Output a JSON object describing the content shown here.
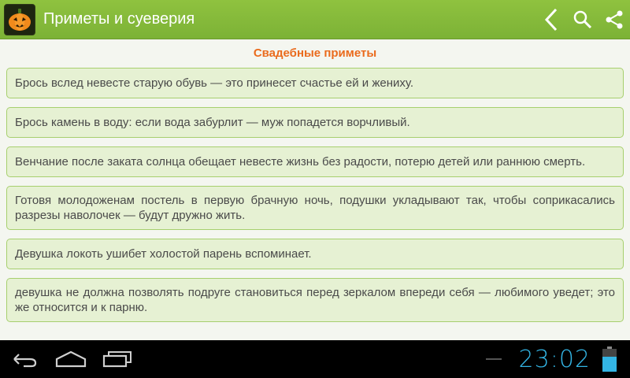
{
  "app": {
    "title": "Приметы и суеверия",
    "icon": "pumpkin-icon"
  },
  "actions": [
    {
      "name": "back-icon"
    },
    {
      "name": "search-icon"
    },
    {
      "name": "share-icon"
    }
  ],
  "section": {
    "title": "Свадебные приметы"
  },
  "items": [
    "Брось вслед невесте старую обувь — это принесет счастье ей и жениху.",
    "Брось камень в воду: если вода забурлит — муж попадется ворчливый.",
    "Венчание после заката солнца обещает невесте жизнь без радости, потерю детей или раннюю смерть.",
    "Готовя молодоженам постель в первую брачную ночь, подушки укладывают так, чтобы соприкасались разрезы наволочек — будут дружно жить.",
    "Девушка локоть ушибет холостой парень вспоминает.",
    "девушка не должна позволять подруге становиться перед зеркалом впереди себя — любимого уведет; это же относится и к парню."
  ],
  "status": {
    "time": "23:02"
  },
  "colors": {
    "actionbar": "#7cb236",
    "accent": "#ea6b1d",
    "card_bg": "#e6f1d3",
    "card_border": "#a7cf6e",
    "clock": "#33b5e5"
  }
}
